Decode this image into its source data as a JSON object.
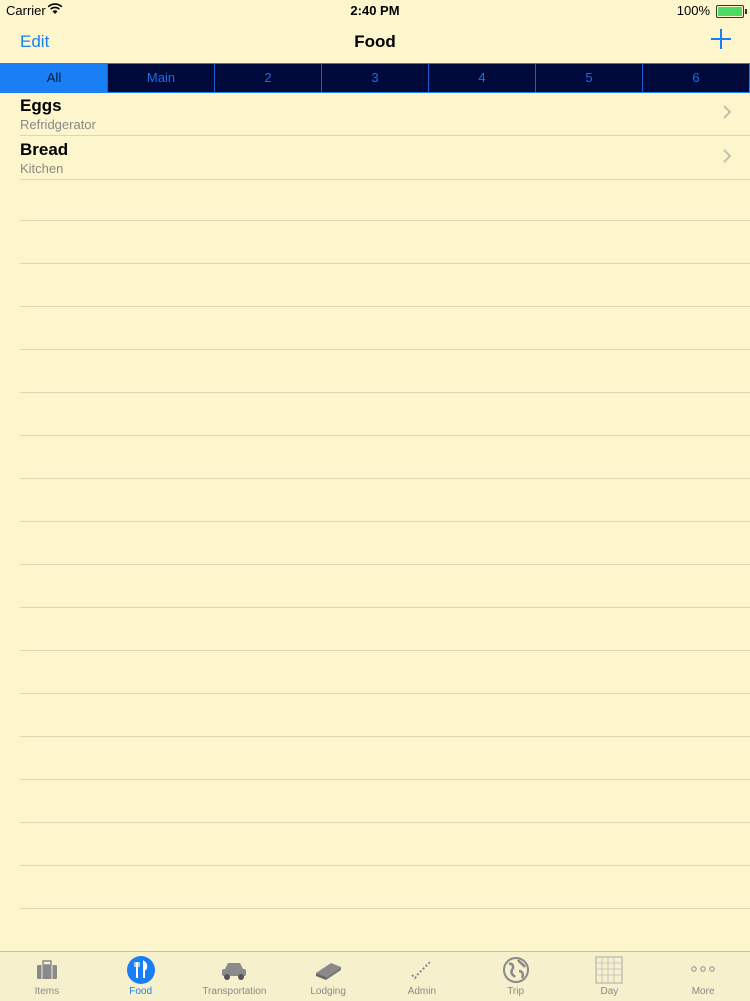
{
  "status_bar": {
    "carrier": "Carrier",
    "time": "2:40 PM",
    "battery": "100%"
  },
  "nav": {
    "edit_label": "Edit",
    "title": "Food"
  },
  "segments": [
    "All",
    "Main",
    "2",
    "3",
    "4",
    "5",
    "6"
  ],
  "selected_segment": "All",
  "items": [
    {
      "name": "Eggs",
      "location": "Refridgerator"
    },
    {
      "name": "Bread",
      "location": "Kitchen"
    }
  ],
  "tabs": [
    {
      "label": "Items",
      "icon": "briefcase-icon"
    },
    {
      "label": "Food",
      "icon": "fork-knife-icon"
    },
    {
      "label": "Transportation",
      "icon": "car-icon"
    },
    {
      "label": "Lodging",
      "icon": "bed-icon"
    },
    {
      "label": "Admin",
      "icon": "checkmarks-icon"
    },
    {
      "label": "Trip",
      "icon": "globe-icon"
    },
    {
      "label": "Day",
      "icon": "calendar-grid-icon"
    },
    {
      "label": "More",
      "icon": "more-dots-icon"
    }
  ],
  "selected_tab": "Food",
  "colors": {
    "accent": "#1a7ef5",
    "background": "#fdf6cc",
    "segment_bg": "#000a3a"
  }
}
